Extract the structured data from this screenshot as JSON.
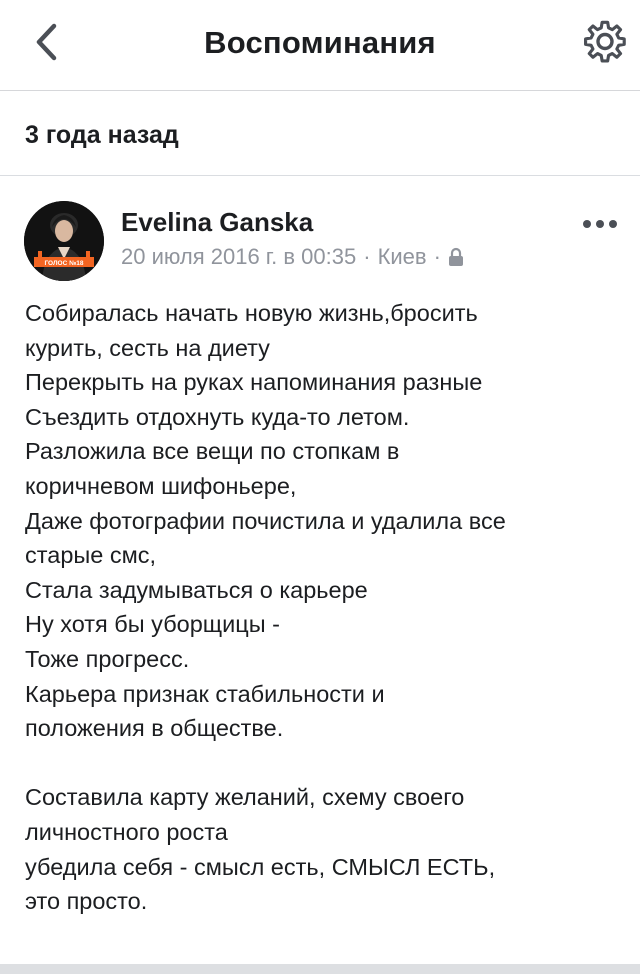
{
  "navbar": {
    "title": "Воспоминания",
    "back_icon": "chevron-left-icon",
    "settings_icon": "gear-icon"
  },
  "section": {
    "title": "3 года назад"
  },
  "post": {
    "author": "Evelina Ganska",
    "avatar_text": "ГОЛОС №18",
    "meta": {
      "date": "20 июля 2016 г. в 00:35",
      "separator": "·",
      "location": "Киев",
      "privacy_icon": "lock-icon"
    },
    "more_icon": "more-horizontal-icon",
    "lines": [
      "Собиралась начать новую жизнь,бросить",
      "курить, сесть на диету",
      "Перекрыть на руках напоминания разные",
      "Съездить отдохнуть куда-то летом.",
      "Разложила все вещи по стопкам в",
      "коричневом шифоньере,",
      "Даже фотографии почистила и удалила все",
      "старые смс,",
      "Стала задумываться о карьере",
      "Ну хотя бы уборщицы -",
      "Тоже прогресс.",
      "Карьера признак стабильности и",
      "положения в обществе.",
      "",
      "Составила карту желаний, схему своего",
      "личностного роста",
      "убедила себя - смысл есть, СМЫСЛ ЕСТЬ,",
      "это просто."
    ]
  },
  "colors": {
    "text": "#1c1e21",
    "meta": "#90949c",
    "divider": "#dadde1",
    "avatar_brand": "#f26522"
  }
}
